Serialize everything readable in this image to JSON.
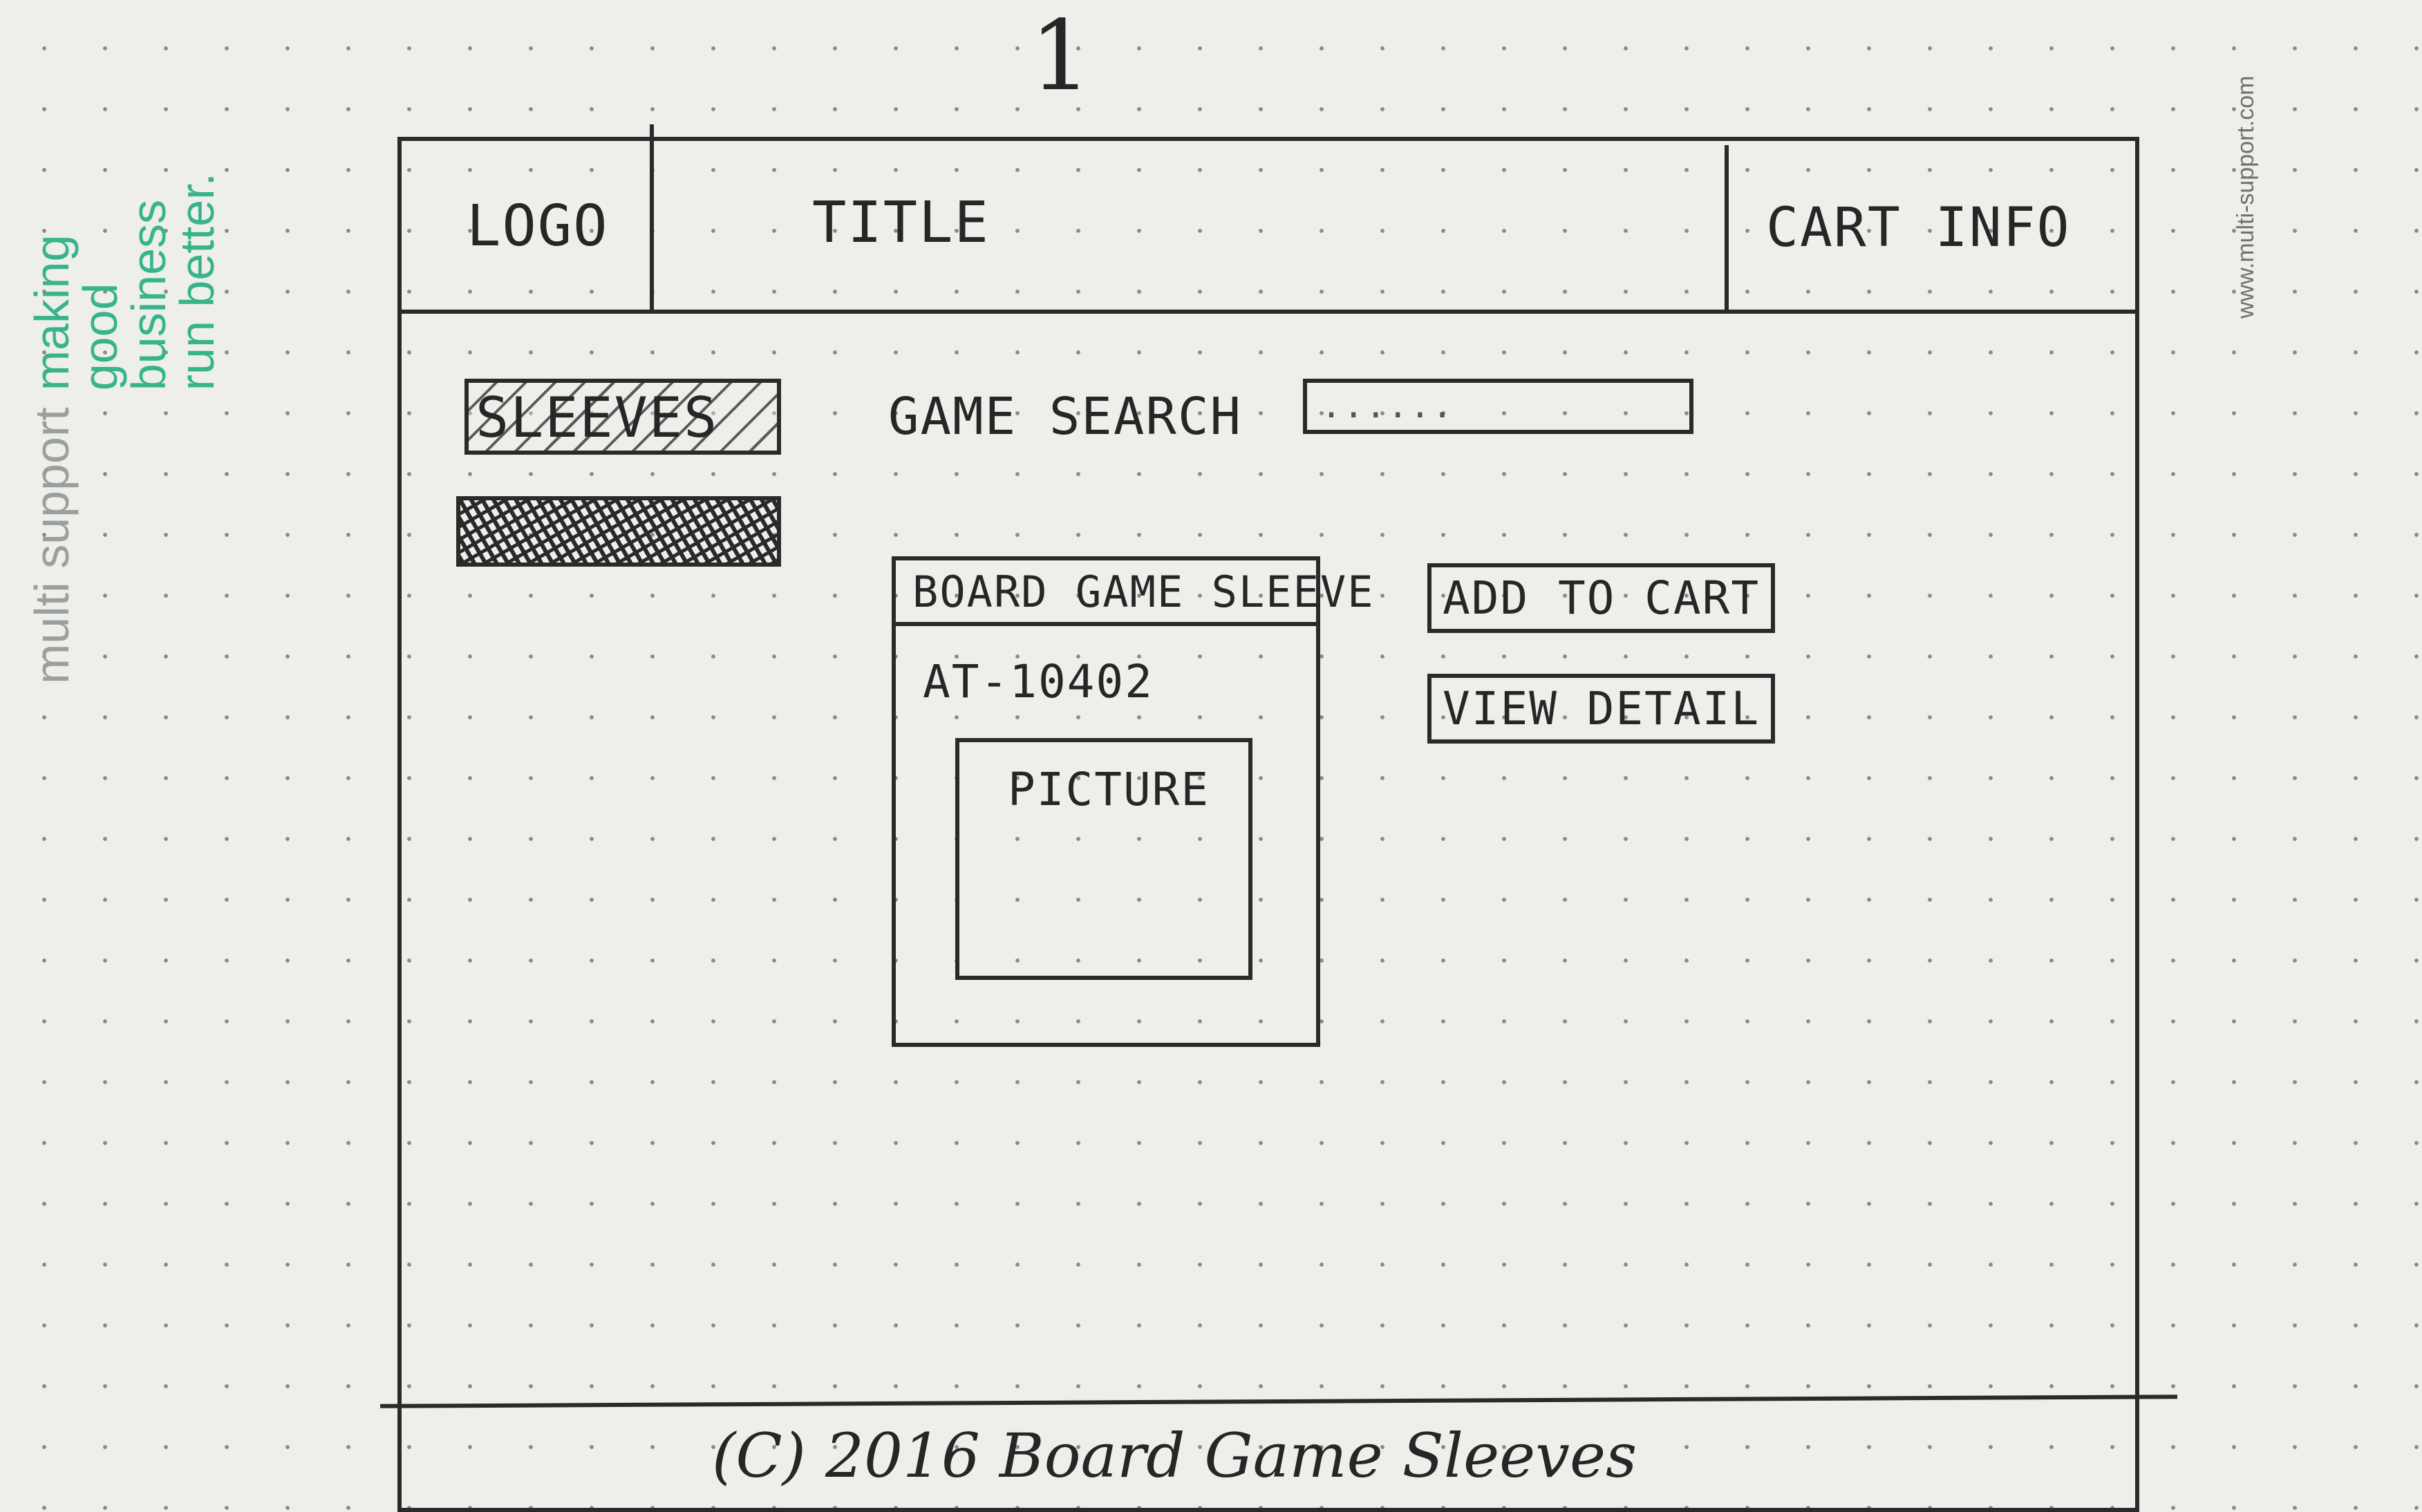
{
  "page_number": "1",
  "notebook": {
    "brand_name": "multi support",
    "brand_tagline": [
      "making",
      "good",
      "business",
      "run better."
    ],
    "website": "www.multi-support.com"
  },
  "header": {
    "logo": "LOGO",
    "title": "TITLE",
    "cart_info": "CART INFO"
  },
  "sidebar": {
    "items": [
      "SLEEVES"
    ]
  },
  "search": {
    "label": "GAME SEARCH",
    "placeholder": "......"
  },
  "product": {
    "title": "BOARD GAME SLEEVE",
    "code": "AT-10402",
    "picture_label": "PICTURE"
  },
  "actions": {
    "add_to_cart": "ADD TO CART",
    "view_detail": "VIEW DETAIL"
  },
  "footer": {
    "copyright": "(C) 2016 Board Game Sleeves"
  }
}
